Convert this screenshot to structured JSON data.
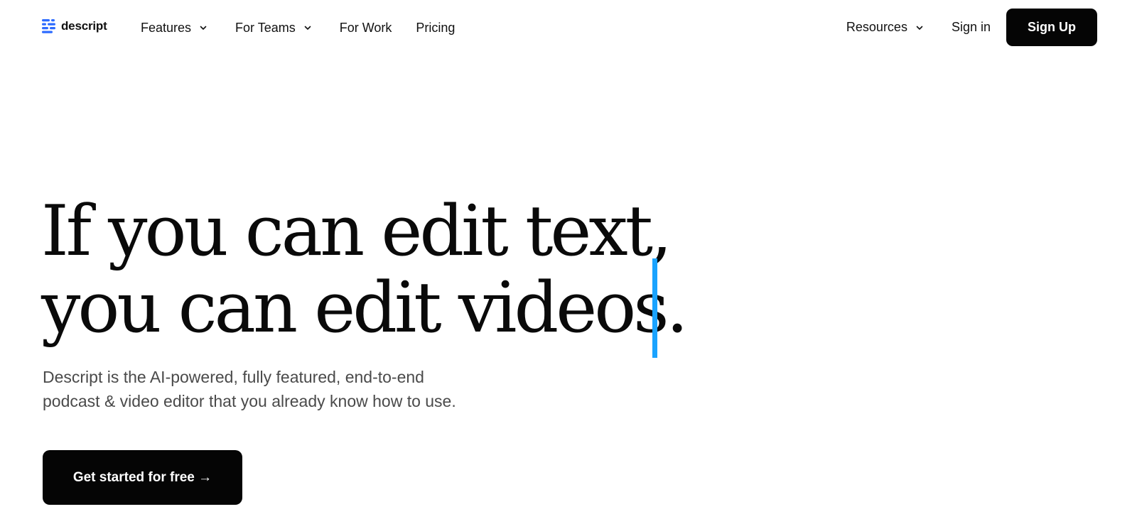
{
  "brand": {
    "name": "descript",
    "accent_color": "#2d6bff"
  },
  "nav": {
    "left_items": [
      {
        "label": "Features",
        "has_dropdown": true
      },
      {
        "label": "For Teams",
        "has_dropdown": true
      },
      {
        "label": "For Work",
        "has_dropdown": false
      },
      {
        "label": "Pricing",
        "has_dropdown": false
      }
    ],
    "resources": {
      "label": "Resources",
      "has_dropdown": true
    },
    "sign_in": "Sign in",
    "sign_up": "Sign Up"
  },
  "hero": {
    "title_line1": "If you can edit text,",
    "title_line2": "you can edit videos.",
    "subtitle_line1": "Descript is the AI-powered, fully featured, end-to-end",
    "subtitle_line2": "podcast & video editor that you already know how to use.",
    "cta": "Get started for free →",
    "cursor_color": "#1aa3ff"
  }
}
